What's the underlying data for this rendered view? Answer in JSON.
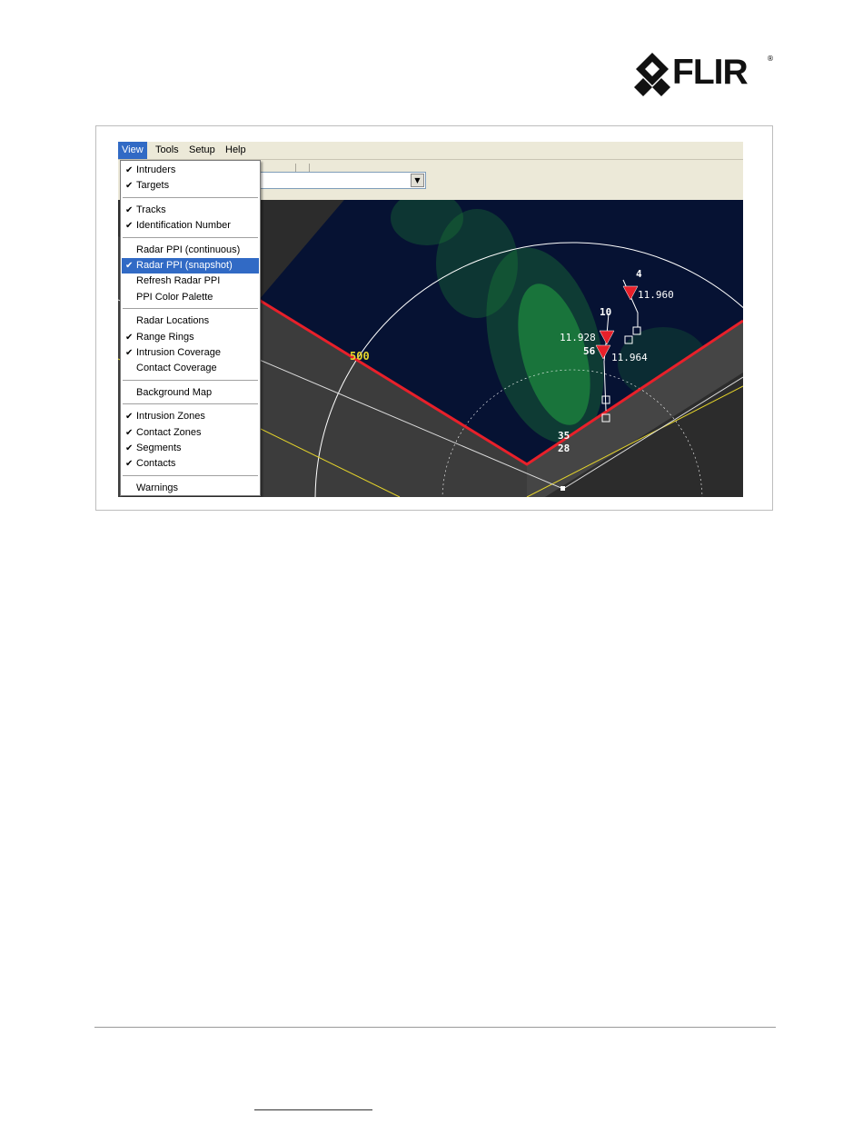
{
  "brand": {
    "logo_text": "FLIR",
    "logo_mark": "®"
  },
  "app": {
    "menubar": [
      {
        "label": "View",
        "active": true
      },
      {
        "label": "Tools",
        "active": false
      },
      {
        "label": "Setup",
        "active": false
      },
      {
        "label": "Help",
        "active": false
      }
    ],
    "view_menu": {
      "groups": [
        [
          {
            "label": "Intruders",
            "checked": true
          },
          {
            "label": "Targets",
            "checked": true
          }
        ],
        [
          {
            "label": "Tracks",
            "checked": true
          },
          {
            "label": "Identification Number",
            "checked": true
          }
        ],
        [
          {
            "label": "Radar PPI (continuous)",
            "checked": false
          },
          {
            "label": "Radar PPI (snapshot)",
            "checked": true,
            "highlighted": true
          },
          {
            "label": "Refresh Radar PPI",
            "checked": false
          },
          {
            "label": "PPI Color Palette",
            "checked": false
          }
        ],
        [
          {
            "label": "Radar Locations",
            "checked": false
          },
          {
            "label": "Range Rings",
            "checked": true
          },
          {
            "label": "Intrusion Coverage",
            "checked": true
          },
          {
            "label": "Contact Coverage",
            "checked": false
          }
        ],
        [
          {
            "label": "Background Map",
            "checked": false
          }
        ],
        [
          {
            "label": "Intrusion Zones",
            "checked": true
          },
          {
            "label": "Contact Zones",
            "checked": true
          },
          {
            "label": "Segments",
            "checked": true
          },
          {
            "label": "Contacts",
            "checked": true
          }
        ],
        [
          {
            "label": "Warnings",
            "checked": false
          }
        ]
      ]
    },
    "combo": {
      "value": "",
      "arrow": "▼"
    },
    "radar": {
      "range_ring_label": "500",
      "track_labels": {
        "t4": "4",
        "t10": "10",
        "t56": "56",
        "t35": "35",
        "t28": "28",
        "v1": "11.960",
        "v2": "11.928",
        "v3": "11.964"
      },
      "colors": {
        "intrusion_zone": "#e8202a",
        "range_ring": "#ffffff",
        "segment": "#e6d52a",
        "clutter": "#2ee04a",
        "coverage": "#061233",
        "ground": "#2c2c2c"
      }
    }
  },
  "check_glyph": "✔"
}
